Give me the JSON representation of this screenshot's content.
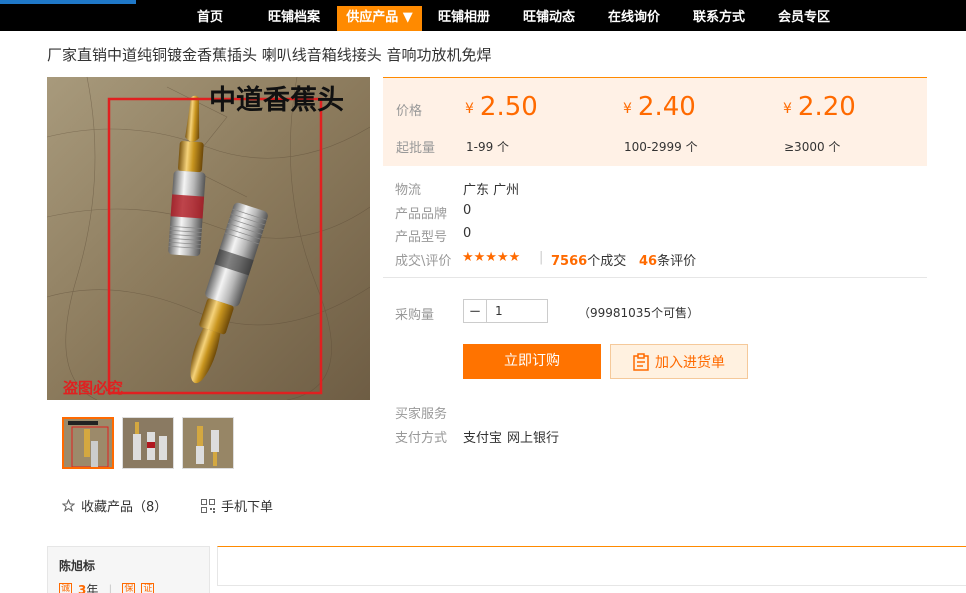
{
  "nav": {
    "items": [
      {
        "label": "首页"
      },
      {
        "label": "旺铺档案"
      },
      {
        "label": "供应产品 ▼"
      },
      {
        "label": "旺铺相册"
      },
      {
        "label": "旺铺动态"
      },
      {
        "label": "在线询价"
      },
      {
        "label": "联系方式"
      },
      {
        "label": "会员专区"
      }
    ],
    "active_index": 2
  },
  "product": {
    "title": "厂家直销中道纯铜镀金香蕉插头 喇叭线音箱线接头 音响功放机免焊",
    "image_text": "中道香蕉头",
    "watermark": "盗图必究"
  },
  "pricing": {
    "price_label": "价格",
    "moq_label": "起批量",
    "currency": "¥",
    "tiers": [
      {
        "price": "2.50",
        "qty": "1-99 个"
      },
      {
        "price": "2.40",
        "qty": "100-2999 个"
      },
      {
        "price": "2.20",
        "qty": "≥3000 个"
      }
    ]
  },
  "details": {
    "logistics_label": "物流",
    "logistics_value": "广东 广州",
    "brand_label": "产品品牌",
    "brand_value": "0",
    "model_label": "产品型号",
    "model_value": "0",
    "trade_label": "成交\\评价",
    "stars": "★★★★★",
    "deals_count": "7566",
    "deals_suffix": "个成交",
    "reviews_count": "46",
    "reviews_suffix": "条评价"
  },
  "purchase": {
    "qty_label": "采购量",
    "qty_value": "1",
    "stock_text": "（99981035个可售）",
    "buy_label": "立即订购",
    "cart_label": "加入进货单"
  },
  "services": {
    "buyer_service_label": "买家服务",
    "payment_label": "支付方式",
    "payment_1": "支付宝",
    "payment_2": "网上银行"
  },
  "actions": {
    "favorite_label": "收藏产品（8）",
    "mobile_label": "手机下单"
  },
  "seller": {
    "name": "陈旭标",
    "years_num": "3",
    "years_unit": "年",
    "badge_1": "诚",
    "badge_2": "保",
    "badge_3": "证"
  },
  "colors": {
    "accent": "#ff6a00",
    "nav_bg": "#000000",
    "nav_active": "#ff8a00",
    "price_bg": "#fff1e6"
  },
  "icons": [
    "star-outline-icon",
    "qr-code-icon",
    "clipboard-icon",
    "minus-icon"
  ]
}
